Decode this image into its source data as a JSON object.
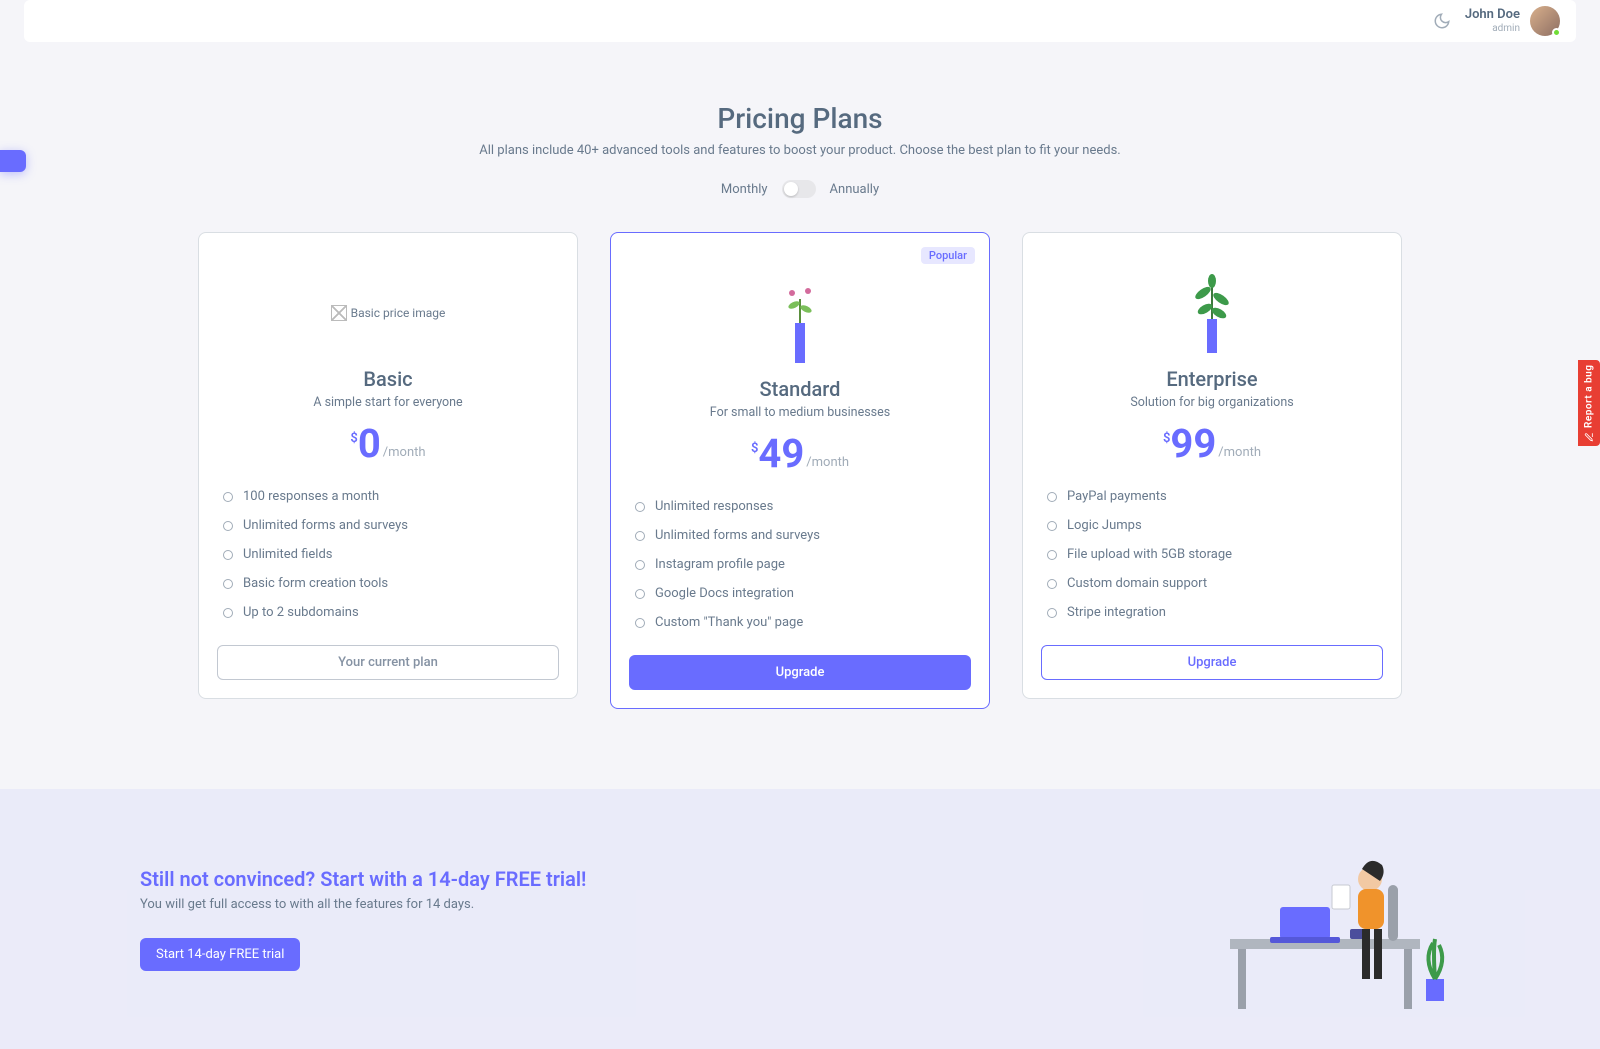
{
  "nav": {
    "user_name": "John Doe",
    "user_role": "admin"
  },
  "header": {
    "title": "Pricing Plans",
    "subtitle": "All plans include 40+ advanced tools and features to boost your product. Choose the best plan to fit your needs."
  },
  "billing_toggle": {
    "left": "Monthly",
    "right": "Annually",
    "state": "monthly"
  },
  "plans": [
    {
      "id": "basic",
      "name": "Basic",
      "subtitle": "A simple start for everyone",
      "price": "0",
      "period": "/month",
      "currency": "$",
      "image_alt": "Basic price image",
      "image_broken": true,
      "popular": false,
      "features": [
        "100 responses a month",
        "Unlimited forms and surveys",
        "Unlimited fields",
        "Basic form creation tools",
        "Up to 2 subdomains"
      ],
      "cta": {
        "label": "Your current plan",
        "variant": "current"
      }
    },
    {
      "id": "standard",
      "name": "Standard",
      "subtitle": "For small to medium businesses",
      "price": "49",
      "period": "/month",
      "currency": "$",
      "popular": true,
      "popular_label": "Popular",
      "features": [
        "Unlimited responses",
        "Unlimited forms and surveys",
        "Instagram profile page",
        "Google Docs integration",
        "Custom \"Thank you\" page"
      ],
      "cta": {
        "label": "Upgrade",
        "variant": "primary"
      }
    },
    {
      "id": "enterprise",
      "name": "Enterprise",
      "subtitle": "Solution for big organizations",
      "price": "99",
      "period": "/month",
      "currency": "$",
      "popular": false,
      "features": [
        "PayPal payments",
        "Logic Jumps",
        "File upload with 5GB storage",
        "Custom domain support",
        "Stripe integration"
      ],
      "cta": {
        "label": "Upgrade",
        "variant": "outline"
      }
    }
  ],
  "cta_band": {
    "title": "Still not convinced? Start with a 14-day FREE trial!",
    "body": "You will get full access to with all the features for 14 days.",
    "button": "Start 14-day FREE trial"
  },
  "side_tabs": {
    "bug_label": "Report a bug"
  }
}
